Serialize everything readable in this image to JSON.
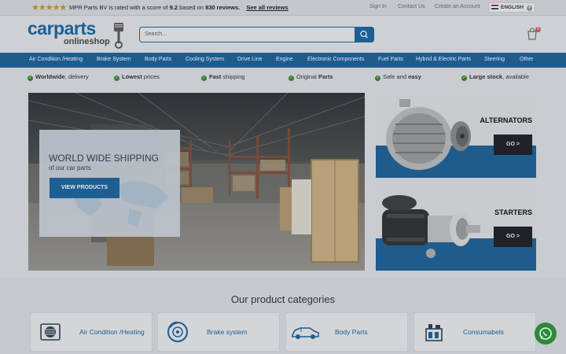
{
  "topbar": {
    "stars": "★★★★★",
    "rating_prefix": "MPR Parts BV is rated with a score of",
    "rating_score": "9.2",
    "rating_mid": "based on",
    "rating_count": "830 reviews.",
    "reviews_link": "See all reviews",
    "links": [
      "Sign In",
      "Contact Us",
      "Create an Account"
    ],
    "language": "ENGLISH"
  },
  "header": {
    "logo_main": "carparts",
    "logo_sub": "onlineshop",
    "search_placeholder": "Search...",
    "cart_count": "0"
  },
  "nav": [
    "Air Condition /Heating",
    "Brake System",
    "Body Parts",
    "Cooling System",
    "Drive Line",
    "Engine",
    "Electronic Components",
    "Fuel Parts",
    "Hybrid & Electric Parts",
    "Steering",
    "Other"
  ],
  "usps": [
    {
      "bold": "Worldwide",
      "rest": ", delivery",
      "bold_first": true
    },
    {
      "bold": "Lowest",
      "rest": " prices",
      "bold_first": true
    },
    {
      "bold": "Fast",
      "rest": " shipping",
      "bold_first": true
    },
    {
      "bold": "Parts",
      "rest": "Original ",
      "bold_first": false
    },
    {
      "bold": "easy",
      "rest": "Safe and ",
      "bold_first": false
    },
    {
      "bold": "Large stock",
      "rest": ", available",
      "bold_first": true
    }
  ],
  "hero": {
    "title": "WORLD WIDE SHIPPING",
    "subtitle": "of our car parts",
    "button": "VIEW PRODUCTS"
  },
  "promos": [
    {
      "title": "ALTERNATORS",
      "button": "GO >"
    },
    {
      "title": "STARTERS",
      "button": "GO >"
    }
  ],
  "categories": {
    "title": "Our product categories",
    "items": [
      "Air Condition /Heating",
      "Brake system",
      "Body Parts",
      "Consumabels"
    ]
  },
  "colors": {
    "brand_blue": "#1f5c8e",
    "check_green": "#3a7a2c",
    "whatsapp": "#2a8a3a"
  }
}
